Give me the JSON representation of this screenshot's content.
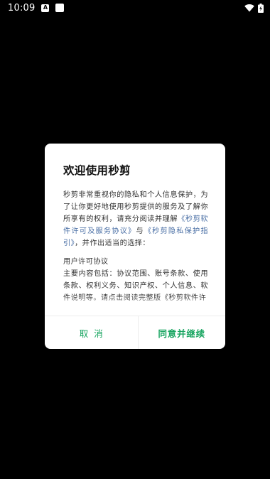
{
  "status_bar": {
    "time": "10:09",
    "notification_letter": "A",
    "icons": [
      "a-notification-icon",
      "square-notification-icon",
      "wifi-icon",
      "battery-charging-icon"
    ]
  },
  "dialog": {
    "title": "欢迎使用秒剪",
    "body": {
      "intro_before_links": "秒剪非常重视你的隐私和个人信息保护，为了让你更好地使用秒剪提供的服务及了解你所享有的权利，请充分阅读并理解",
      "link_license": "《秒剪软件许可及服务协议》",
      "between_links": "与",
      "link_privacy": "《秒剪隐私保护指引》",
      "intro_after_links": "，并作出适当的选择：",
      "section_title": "用户许可协议",
      "section_text": "主要内容包括：协议范围、账号条款、使用条款、权利义务、知识产权、个人信息、软件说明等。请点击阅读完整版《秒剪软件许"
    },
    "cancel_label": "取消",
    "confirm_label": "同意并继续"
  },
  "colors": {
    "background": "#000000",
    "dialog": "#ffffff",
    "accent_green": "#16a45f",
    "link_blue": "#4a6fa5"
  }
}
